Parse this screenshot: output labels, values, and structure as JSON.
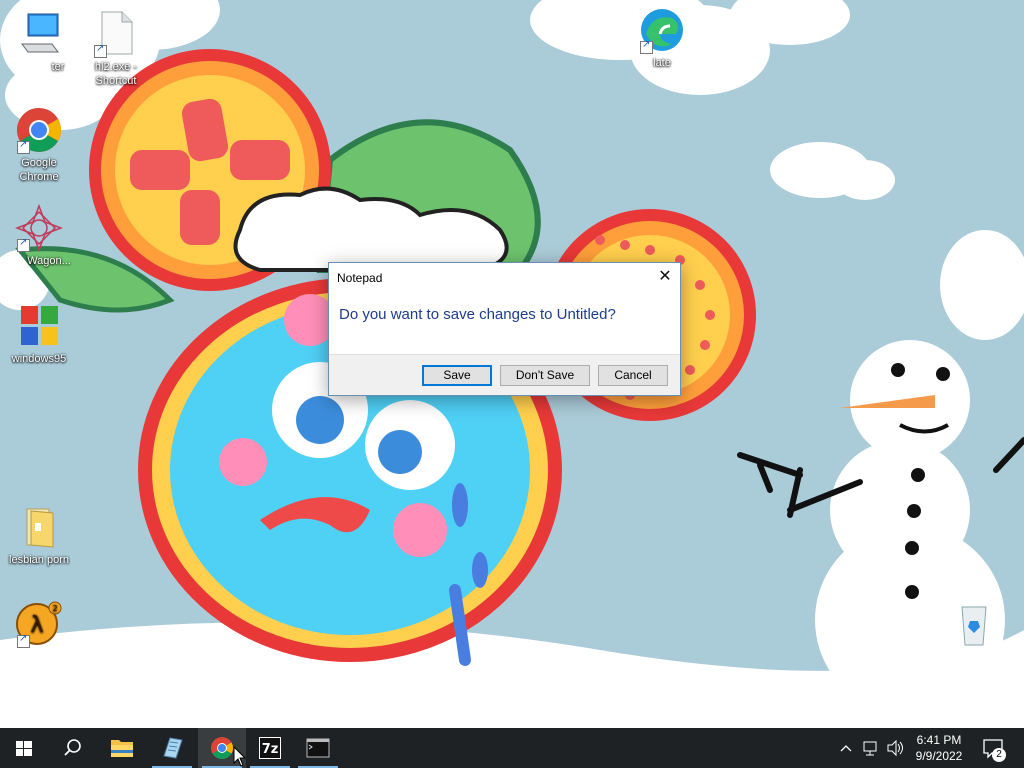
{
  "desktop": {
    "icons": [
      {
        "label": "This PC",
        "display": "ter"
      },
      {
        "label": "hl2.exe - Shortcut"
      },
      {
        "label": "latest",
        "display": "late"
      },
      {
        "label": "Google Chrome"
      },
      {
        "label": "Wagon...",
        "display": "Wagon..."
      },
      {
        "label": "windows95"
      },
      {
        "label": "lesbian porn"
      },
      {
        "label": "Half-Life 2"
      },
      {
        "label": "Recycle Bin"
      }
    ]
  },
  "dialog": {
    "title": "Notepad",
    "message": "Do you want to save changes to Untitled?",
    "buttons": {
      "save": "Save",
      "dont_save": "Don't Save",
      "cancel": "Cancel"
    },
    "close_symbol": "✕"
  },
  "taskbar": {
    "clock": {
      "time": "6:41 PM",
      "date": "9/9/2022"
    },
    "notifications": "2"
  },
  "colors": {
    "dialog_text": "#1e3c8c",
    "taskbar": "#1f2224",
    "accent": "#0078d7"
  }
}
